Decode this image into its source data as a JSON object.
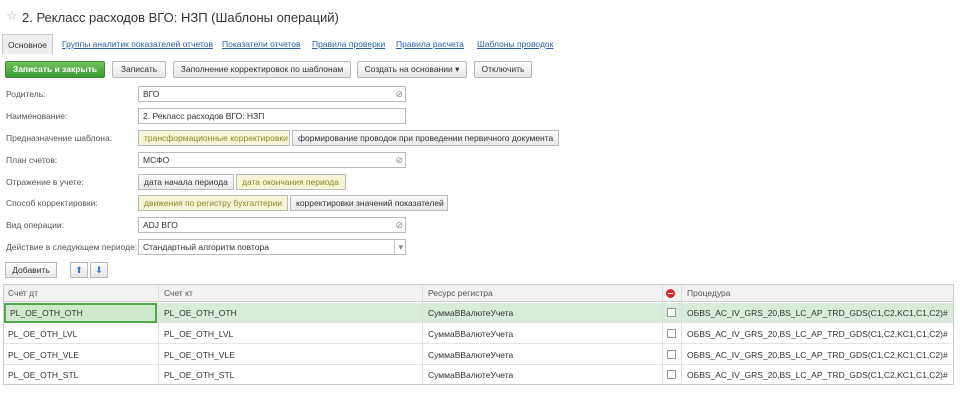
{
  "window": {
    "title": "2. Рекласс расходов ВГО: НЗП (Шаблоны операций)"
  },
  "tabs": [
    {
      "label": "Основное"
    },
    {
      "label": "Группы аналитик показателей отчетов"
    },
    {
      "label": "Показатели отчетов"
    },
    {
      "label": "Правила проверки"
    },
    {
      "label": "Правила расчета"
    },
    {
      "label": "Шаблоны проводок"
    }
  ],
  "toolbar": {
    "save_close": "Записать и закрыть",
    "save": "Записать",
    "fill": "Заполнение корректировок по шаблонам",
    "create_based": "Создать на основании",
    "disable": "Отключить"
  },
  "form": {
    "parent": {
      "label": "Родитель:",
      "value": "ВГО"
    },
    "name": {
      "label": "Наименование:",
      "value": "2. Рекласс расходов ВГО: НЗП"
    },
    "purpose": {
      "label": "Предназначение шаблона:",
      "opt1": "трансформационные корректировки",
      "opt2": "формирование проводок при проведении первичного документа"
    },
    "chart": {
      "label": "План счетов:",
      "value": "МСФО"
    },
    "reflection": {
      "label": "Отражение в учете:",
      "opt1": "дата начала периода",
      "opt2": "дата окончания периода"
    },
    "method": {
      "label": "Способ корректировки:",
      "opt1": "движения по регистру бухгалтерии",
      "opt2": "корректировки значений показателей"
    },
    "op_type": {
      "label": "Вид операции:",
      "value": "ADJ ВГО"
    },
    "next_action": {
      "label": "Действие в следующем периоде:",
      "value": "Стандартный алгоритм повтора"
    }
  },
  "table_toolbar": {
    "add": "Добавить"
  },
  "table": {
    "headers": [
      "Счет дт",
      "Счет кт",
      "Ресурс регистра",
      "Процедура"
    ],
    "rows": [
      [
        "PL_OE_OTH_OTH",
        "PL_OE_OTH_OTH",
        "СуммаВВалютеУчета",
        "OБВS_AC_IV_GRS_20,BS_LC_AP_TRD_GDS(C1,C2,KC1,C1,C2)#"
      ],
      [
        "PL_OE_OTH_LVL",
        "PL_OE_OTH_LVL",
        "СуммаВВалютеУчета",
        "OБВS_AC_IV_GRS_20,BS_LC_AP_TRD_GDS(C1,C2,KC1,C1,C2)#"
      ],
      [
        "PL_OE_OTH_VLE",
        "PL_OE_OTH_VLE",
        "СуммаВВалютеУчета",
        "OБВS_AC_IV_GRS_20,BS_LC_AP_TRD_GDS(C1,C2,KC1,C1,C2)#"
      ],
      [
        "PL_OE_OTH_STL",
        "PL_OE_OTH_STL",
        "СуммаВВалютеУчета",
        "OБВS_AC_IV_GRS_20,BS_LC_AP_TRD_GDS(C1,C2,KC1,C1,C2)#"
      ]
    ]
  },
  "icons": {
    "star": "star-icon",
    "link": "link-icon",
    "dropdown": "chevron-down-icon",
    "up": "arrow-up-icon",
    "down": "arrow-down-icon",
    "stop": "stop-icon"
  },
  "colors": {
    "primary_button": "#4aa83e",
    "selected_row": "#d9ecd9",
    "link": "#2b5ea9",
    "toggle_on": "#f7f5d8"
  }
}
